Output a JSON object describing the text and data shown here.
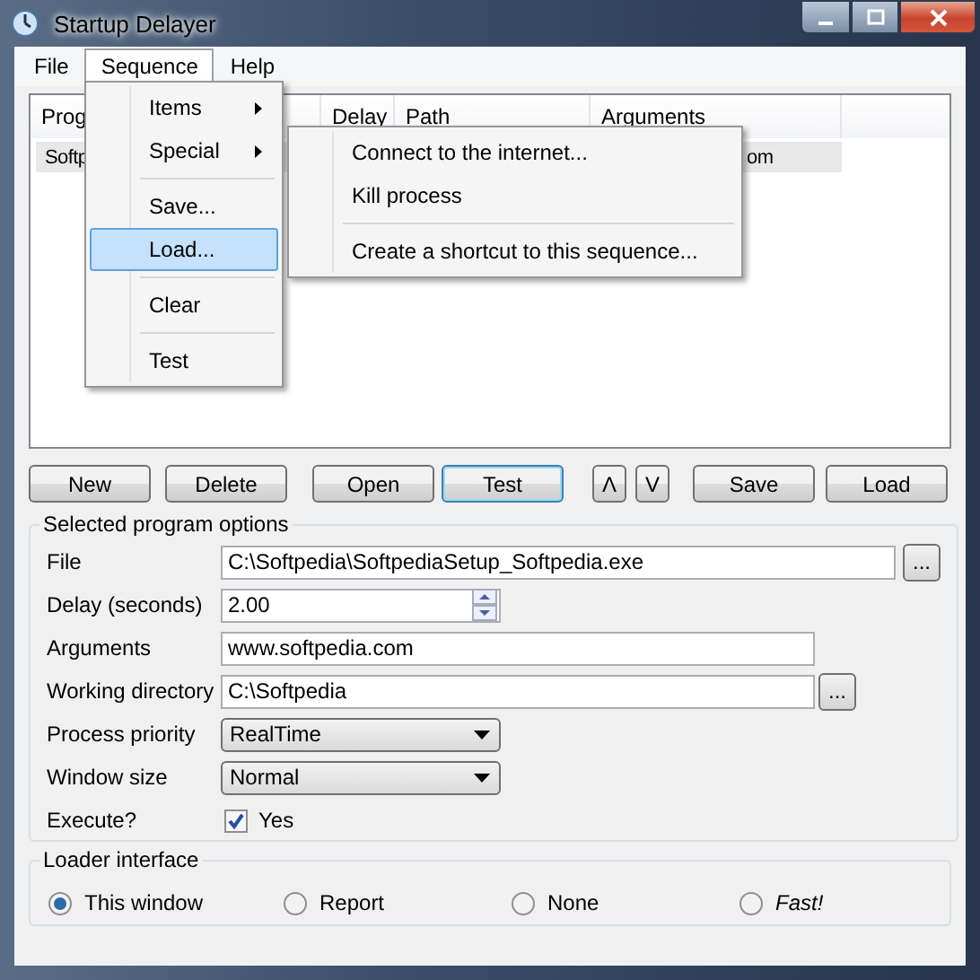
{
  "window": {
    "title": "Startup Delayer"
  },
  "menu_bar": [
    {
      "label": "File",
      "selected": false
    },
    {
      "label": "Sequence",
      "selected": true
    },
    {
      "label": "Help",
      "selected": false
    }
  ],
  "sequence_menu": [
    {
      "kind": "item",
      "label": "Items",
      "submenu": true,
      "selected": false
    },
    {
      "kind": "item",
      "label": "Special",
      "submenu": true,
      "selected": false
    },
    {
      "kind": "separator"
    },
    {
      "kind": "item",
      "label": "Save...",
      "submenu": false,
      "selected": false
    },
    {
      "kind": "item",
      "label": "Load...",
      "submenu": false,
      "selected": true
    },
    {
      "kind": "separator"
    },
    {
      "kind": "item",
      "label": "Clear",
      "submenu": false,
      "selected": false
    },
    {
      "kind": "separator"
    },
    {
      "kind": "item",
      "label": "Test",
      "submenu": false,
      "selected": false
    }
  ],
  "special_submenu": [
    {
      "kind": "item",
      "label": "Connect to the internet...",
      "selected": false
    },
    {
      "kind": "item",
      "label": "Kill process",
      "selected": false
    },
    {
      "kind": "separator"
    },
    {
      "kind": "item",
      "label": "Create a shortcut to this sequence...",
      "selected": false
    }
  ],
  "list": {
    "columns": [
      "Prog",
      "Delay",
      "Path",
      "Arguments"
    ],
    "rows": [
      {
        "cells": [
          "Softp",
          "",
          "",
          "om"
        ],
        "selected": true
      }
    ]
  },
  "buttons": [
    {
      "label": "New",
      "focused": false
    },
    {
      "label": "Delete",
      "focused": false
    },
    {
      "label": "Open",
      "focused": false
    },
    {
      "label": "Test",
      "focused": true
    },
    {
      "label": "Λ",
      "focused": false
    },
    {
      "label": "V",
      "focused": false
    },
    {
      "label": "Save",
      "focused": false
    },
    {
      "label": "Load",
      "focused": false
    }
  ],
  "options": {
    "title": "Selected program options",
    "rows": [
      {
        "kind": "text",
        "label": "File",
        "value": "C:\\Softpedia\\SoftpediaSetup_Softpedia.exe",
        "browse": "..."
      },
      {
        "kind": "spin",
        "label": "Delay (seconds)",
        "value": "2.00"
      },
      {
        "kind": "text",
        "label": "Arguments",
        "value": "www.softpedia.com"
      },
      {
        "kind": "text",
        "label": "Working directory",
        "value": "C:\\Softpedia",
        "browse": "..."
      },
      {
        "kind": "combo",
        "label": "Process priority",
        "value": "RealTime"
      },
      {
        "kind": "combo",
        "label": "Window size",
        "value": "Normal"
      },
      {
        "kind": "checkbox",
        "label": "Execute?",
        "value": "Yes",
        "checked": true
      }
    ]
  },
  "loader": {
    "title": "Loader interface",
    "options": [
      {
        "label": "This window",
        "selected": true,
        "italic": false
      },
      {
        "label": "Report",
        "selected": false,
        "italic": false
      },
      {
        "label": "None",
        "selected": false,
        "italic": false
      },
      {
        "label": "Fast!",
        "selected": false,
        "italic": true
      }
    ]
  }
}
